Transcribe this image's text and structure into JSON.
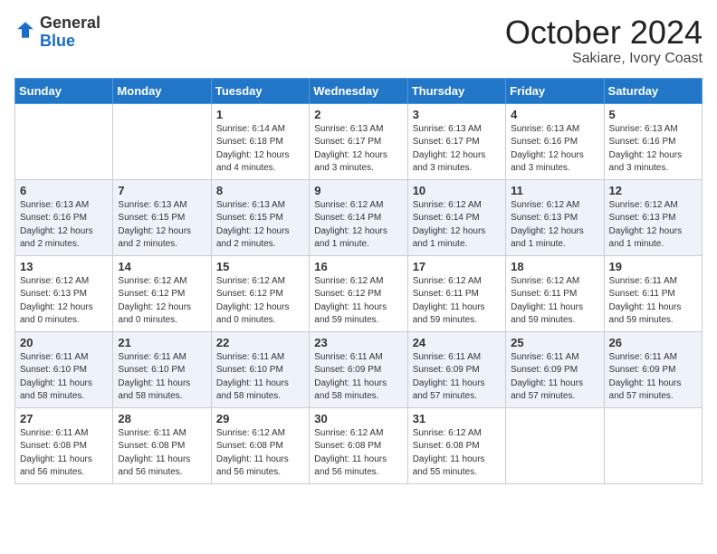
{
  "header": {
    "logo_general": "General",
    "logo_blue": "Blue",
    "month_title": "October 2024",
    "location": "Sakiare, Ivory Coast"
  },
  "days_of_week": [
    "Sunday",
    "Monday",
    "Tuesday",
    "Wednesday",
    "Thursday",
    "Friday",
    "Saturday"
  ],
  "weeks": [
    [
      {
        "day": "",
        "info": ""
      },
      {
        "day": "",
        "info": ""
      },
      {
        "day": "1",
        "info": "Sunrise: 6:14 AM\nSunset: 6:18 PM\nDaylight: 12 hours and 4 minutes."
      },
      {
        "day": "2",
        "info": "Sunrise: 6:13 AM\nSunset: 6:17 PM\nDaylight: 12 hours and 3 minutes."
      },
      {
        "day": "3",
        "info": "Sunrise: 6:13 AM\nSunset: 6:17 PM\nDaylight: 12 hours and 3 minutes."
      },
      {
        "day": "4",
        "info": "Sunrise: 6:13 AM\nSunset: 6:16 PM\nDaylight: 12 hours and 3 minutes."
      },
      {
        "day": "5",
        "info": "Sunrise: 6:13 AM\nSunset: 6:16 PM\nDaylight: 12 hours and 3 minutes."
      }
    ],
    [
      {
        "day": "6",
        "info": "Sunrise: 6:13 AM\nSunset: 6:16 PM\nDaylight: 12 hours and 2 minutes."
      },
      {
        "day": "7",
        "info": "Sunrise: 6:13 AM\nSunset: 6:15 PM\nDaylight: 12 hours and 2 minutes."
      },
      {
        "day": "8",
        "info": "Sunrise: 6:13 AM\nSunset: 6:15 PM\nDaylight: 12 hours and 2 minutes."
      },
      {
        "day": "9",
        "info": "Sunrise: 6:12 AM\nSunset: 6:14 PM\nDaylight: 12 hours and 1 minute."
      },
      {
        "day": "10",
        "info": "Sunrise: 6:12 AM\nSunset: 6:14 PM\nDaylight: 12 hours and 1 minute."
      },
      {
        "day": "11",
        "info": "Sunrise: 6:12 AM\nSunset: 6:13 PM\nDaylight: 12 hours and 1 minute."
      },
      {
        "day": "12",
        "info": "Sunrise: 6:12 AM\nSunset: 6:13 PM\nDaylight: 12 hours and 1 minute."
      }
    ],
    [
      {
        "day": "13",
        "info": "Sunrise: 6:12 AM\nSunset: 6:13 PM\nDaylight: 12 hours and 0 minutes."
      },
      {
        "day": "14",
        "info": "Sunrise: 6:12 AM\nSunset: 6:12 PM\nDaylight: 12 hours and 0 minutes."
      },
      {
        "day": "15",
        "info": "Sunrise: 6:12 AM\nSunset: 6:12 PM\nDaylight: 12 hours and 0 minutes."
      },
      {
        "day": "16",
        "info": "Sunrise: 6:12 AM\nSunset: 6:12 PM\nDaylight: 11 hours and 59 minutes."
      },
      {
        "day": "17",
        "info": "Sunrise: 6:12 AM\nSunset: 6:11 PM\nDaylight: 11 hours and 59 minutes."
      },
      {
        "day": "18",
        "info": "Sunrise: 6:12 AM\nSunset: 6:11 PM\nDaylight: 11 hours and 59 minutes."
      },
      {
        "day": "19",
        "info": "Sunrise: 6:11 AM\nSunset: 6:11 PM\nDaylight: 11 hours and 59 minutes."
      }
    ],
    [
      {
        "day": "20",
        "info": "Sunrise: 6:11 AM\nSunset: 6:10 PM\nDaylight: 11 hours and 58 minutes."
      },
      {
        "day": "21",
        "info": "Sunrise: 6:11 AM\nSunset: 6:10 PM\nDaylight: 11 hours and 58 minutes."
      },
      {
        "day": "22",
        "info": "Sunrise: 6:11 AM\nSunset: 6:10 PM\nDaylight: 11 hours and 58 minutes."
      },
      {
        "day": "23",
        "info": "Sunrise: 6:11 AM\nSunset: 6:09 PM\nDaylight: 11 hours and 58 minutes."
      },
      {
        "day": "24",
        "info": "Sunrise: 6:11 AM\nSunset: 6:09 PM\nDaylight: 11 hours and 57 minutes."
      },
      {
        "day": "25",
        "info": "Sunrise: 6:11 AM\nSunset: 6:09 PM\nDaylight: 11 hours and 57 minutes."
      },
      {
        "day": "26",
        "info": "Sunrise: 6:11 AM\nSunset: 6:09 PM\nDaylight: 11 hours and 57 minutes."
      }
    ],
    [
      {
        "day": "27",
        "info": "Sunrise: 6:11 AM\nSunset: 6:08 PM\nDaylight: 11 hours and 56 minutes."
      },
      {
        "day": "28",
        "info": "Sunrise: 6:11 AM\nSunset: 6:08 PM\nDaylight: 11 hours and 56 minutes."
      },
      {
        "day": "29",
        "info": "Sunrise: 6:12 AM\nSunset: 6:08 PM\nDaylight: 11 hours and 56 minutes."
      },
      {
        "day": "30",
        "info": "Sunrise: 6:12 AM\nSunset: 6:08 PM\nDaylight: 11 hours and 56 minutes."
      },
      {
        "day": "31",
        "info": "Sunrise: 6:12 AM\nSunset: 6:08 PM\nDaylight: 11 hours and 55 minutes."
      },
      {
        "day": "",
        "info": ""
      },
      {
        "day": "",
        "info": ""
      }
    ]
  ]
}
